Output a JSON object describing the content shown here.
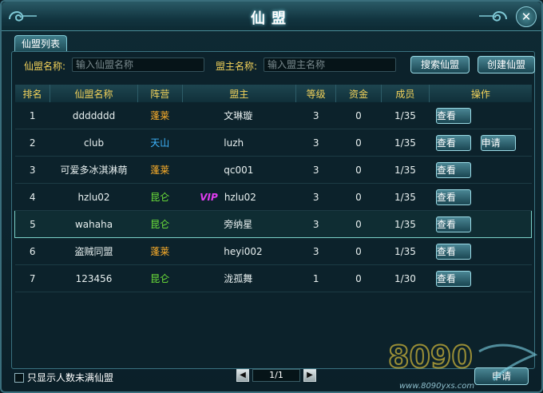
{
  "window": {
    "title": "仙盟"
  },
  "tabs": [
    {
      "label": "仙盟列表"
    }
  ],
  "search": {
    "guild_name_label": "仙盟名称:",
    "guild_name_placeholder": "输入仙盟名称",
    "leader_label": "盟主名称:",
    "leader_placeholder": "输入盟主名称",
    "search_button": "搜索仙盟",
    "create_button": "创建仙盟"
  },
  "table": {
    "headers": [
      "排名",
      "仙盟名称",
      "阵营",
      "盟主",
      "等级",
      "资金",
      "成员",
      "操作"
    ],
    "rows": [
      {
        "rank": "1",
        "name": "ddddddd",
        "faction": "蓬莱",
        "leader": "文琳璇",
        "level": "3",
        "funds": "0",
        "members": "1/35",
        "view": "查看",
        "apply": ""
      },
      {
        "rank": "2",
        "name": "club",
        "faction": "天山",
        "leader": "luzh",
        "level": "3",
        "funds": "0",
        "members": "1/35",
        "view": "查看",
        "apply": "申请"
      },
      {
        "rank": "3",
        "name": "可爱多冰淇淋萌",
        "faction": "蓬莱",
        "leader": "qc001",
        "level": "3",
        "funds": "0",
        "members": "1/35",
        "view": "查看",
        "apply": ""
      },
      {
        "rank": "4",
        "name": "hzlu02",
        "faction": "昆仑",
        "leader": "hzlu02",
        "vip": "VIP",
        "level": "3",
        "funds": "0",
        "members": "1/35",
        "view": "查看",
        "apply": ""
      },
      {
        "rank": "5",
        "name": "wahaha",
        "faction": "昆仑",
        "leader": "旁纳星",
        "level": "3",
        "funds": "0",
        "members": "1/35",
        "view": "查看",
        "apply": ""
      },
      {
        "rank": "6",
        "name": "盗贼同盟",
        "faction": "蓬莱",
        "leader": "heyi002",
        "level": "3",
        "funds": "0",
        "members": "1/35",
        "view": "查看",
        "apply": ""
      },
      {
        "rank": "7",
        "name": "123456",
        "faction": "昆仑",
        "leader": "泷孤舞",
        "level": "1",
        "funds": "0",
        "members": "1/30",
        "view": "查看",
        "apply": ""
      }
    ]
  },
  "footer": {
    "checkbox_label": "只显示人数未满仙盟",
    "pager_text": "1/1",
    "prev_icon": "◀",
    "next_icon": "▶",
    "apply_button": "申请"
  },
  "watermark": {
    "brand": "8090",
    "url": "www.8090yxs.com"
  },
  "colors": {
    "gold": "#f2d25a",
    "penglai": "#ffb02a",
    "tianshan": "#3fb6ff",
    "kunlun": "#6fe63a",
    "vip": "#e03cf0"
  }
}
